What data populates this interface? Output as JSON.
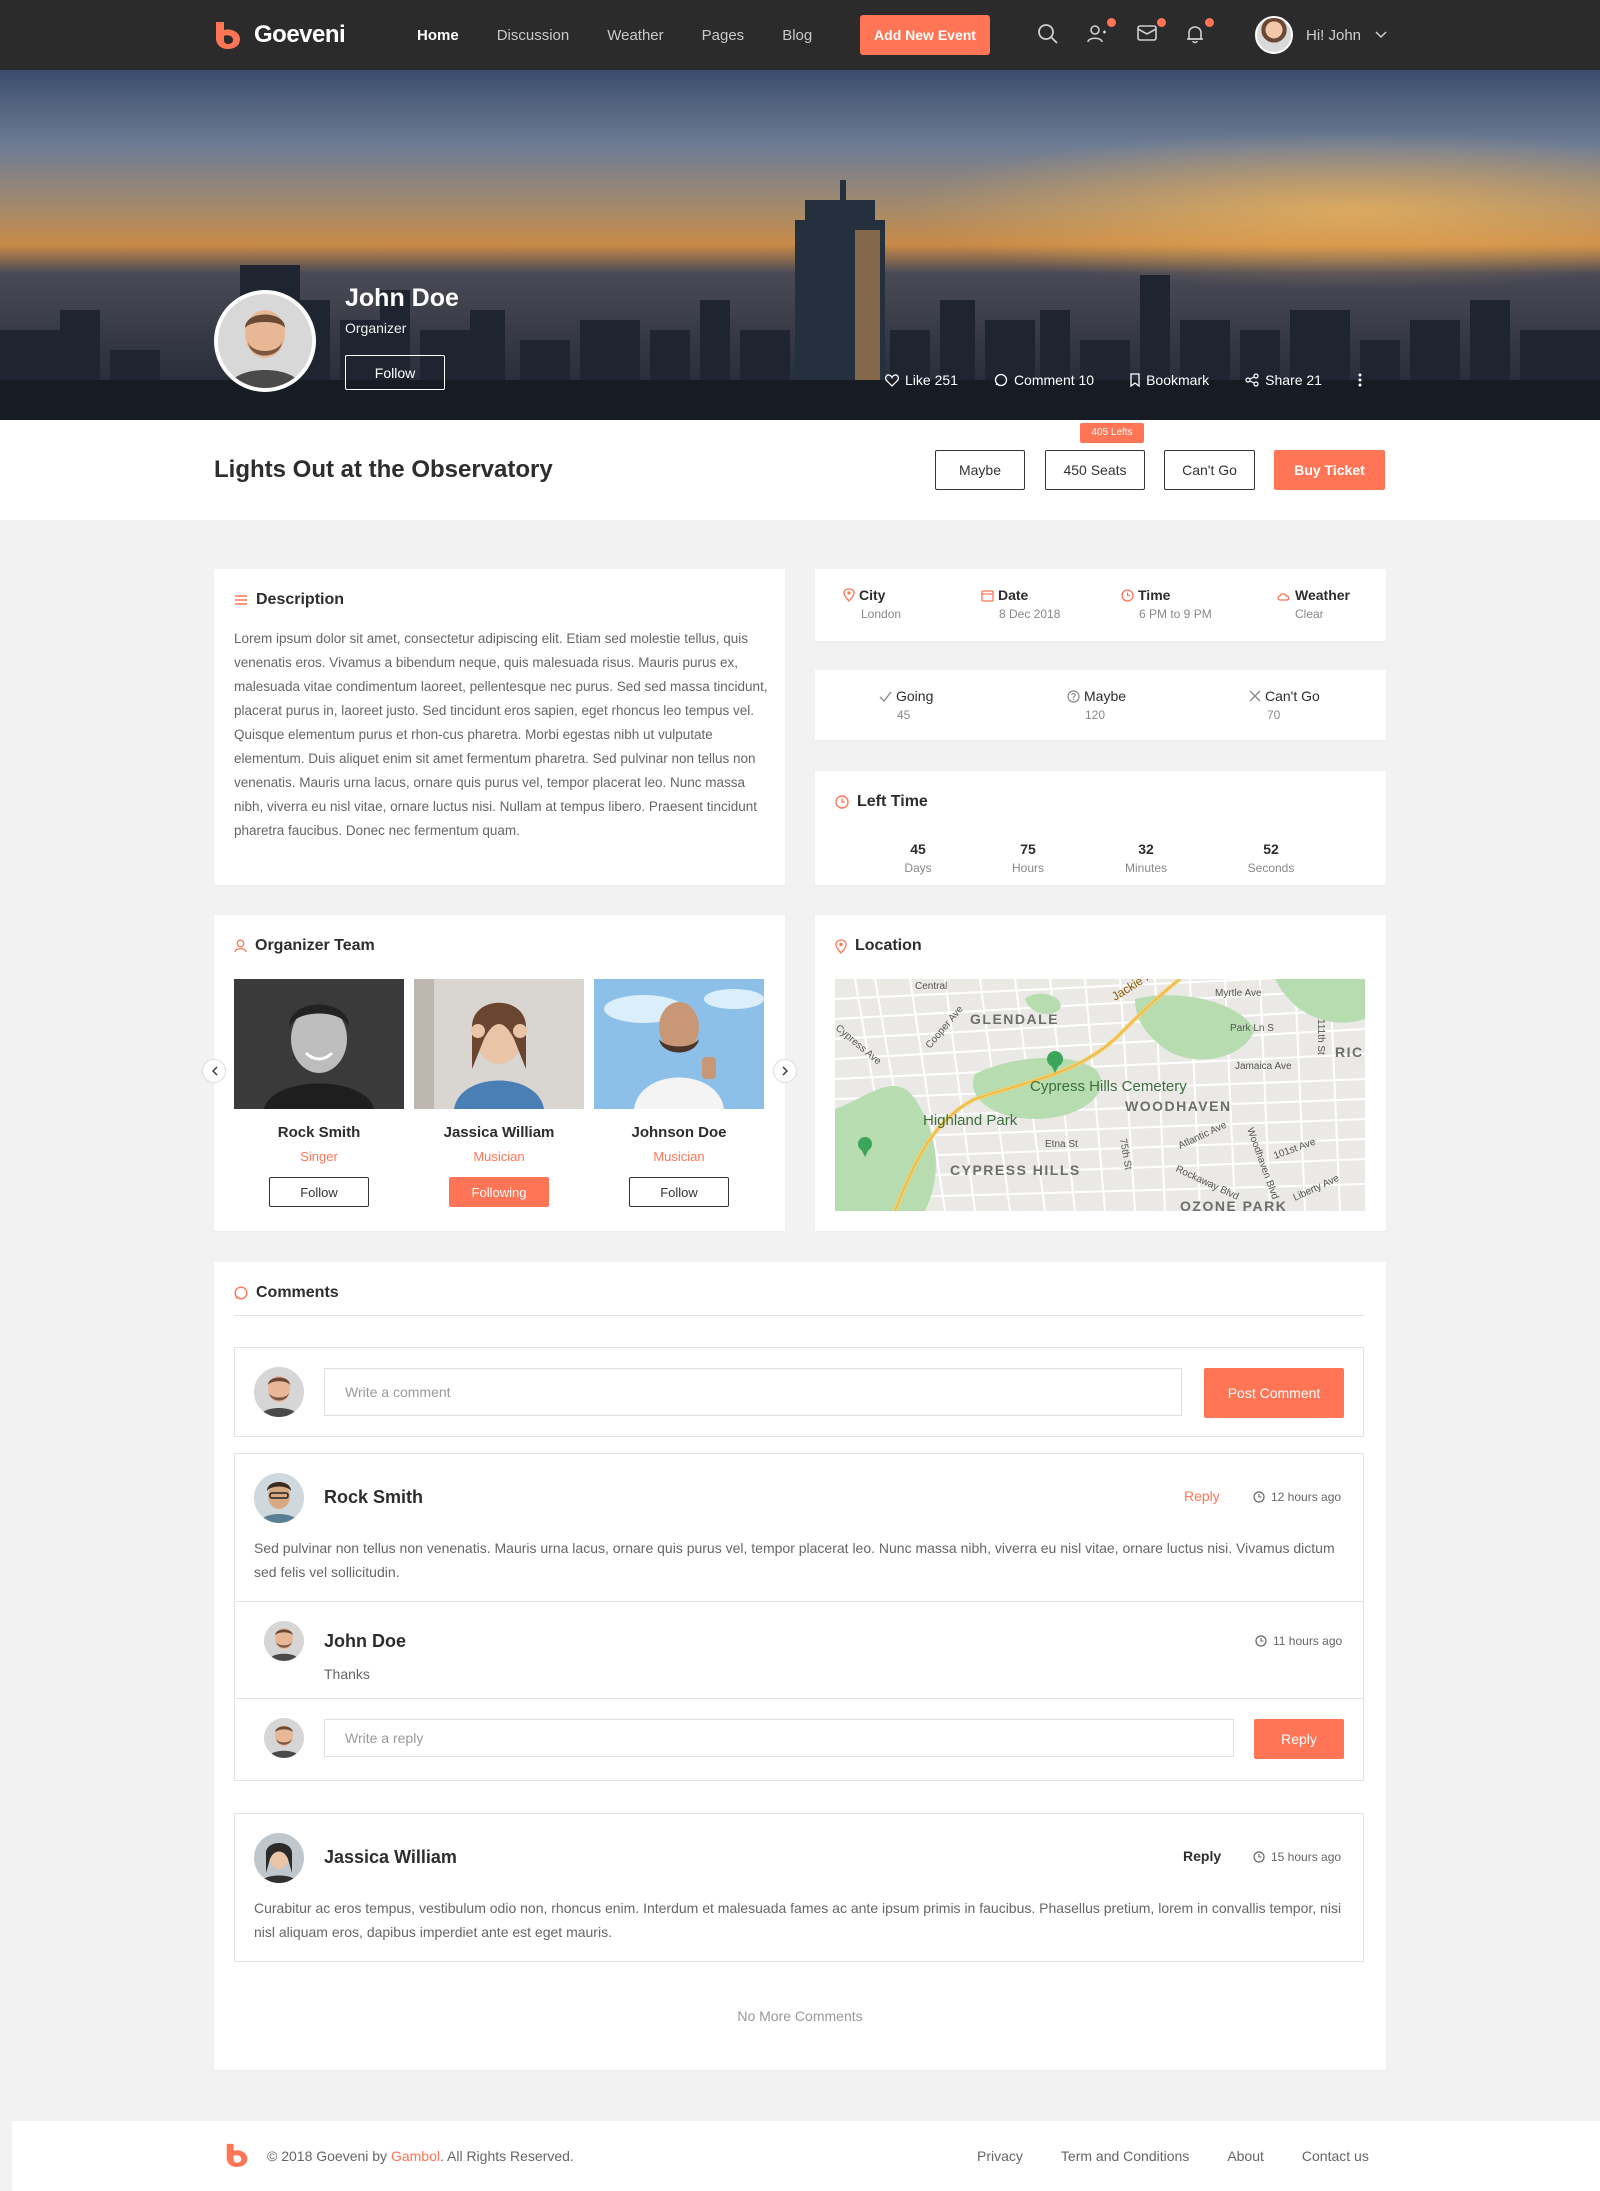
{
  "header": {
    "brand": "Goeveni",
    "nav": [
      "Home",
      "Discussion",
      "Weather",
      "Pages",
      "Blog"
    ],
    "add_event": "Add New Event",
    "greeting": "Hi! John"
  },
  "hero": {
    "name": "John Doe",
    "role": "Organizer",
    "follow": "Follow",
    "actions": {
      "like": "Like 251",
      "comment": "Comment 10",
      "bookmark": "Bookmark",
      "share": "Share 21"
    }
  },
  "event": {
    "title": "Lights Out at the Observatory",
    "maybe": "Maybe",
    "seats": "450 Seats",
    "lefts": "405 Lefts",
    "cant_go": "Can't Go",
    "buy": "Buy Ticket"
  },
  "description": {
    "title": "Description",
    "text": "Lorem ipsum dolor sit amet, consectetur adipiscing elit. Etiam sed molestie tellus, quis venenatis eros. Vivamus a bibendum neque, quis malesuada risus. Mauris purus ex, malesuada vitae condimentum laoreet, pellentesque nec purus. Sed sed massa tincidunt, placerat purus in, laoreet justo. Sed tincidunt eros sapien, eget rhoncus leo tempus vel. Quisque elementum purus et rhon-cus pharetra. Morbi egestas nibh ut vulputate elementum. Duis aliquet enim sit amet fermentum pharetra. Sed pulvinar non tellus non venenatis. Mauris urna lacus, ornare quis purus vel, tempor placerat leo. Nunc massa nibh, viverra eu nisl vitae, ornare luctus nisi. Nullam at tempus libero. Praesent tincidunt pharetra faucibus. Donec nec fermentum quam."
  },
  "info": [
    {
      "label": "City",
      "value": "London"
    },
    {
      "label": "Date",
      "value": "8 Dec 2018"
    },
    {
      "label": "Time",
      "value": "6 PM to 9 PM"
    },
    {
      "label": "Weather",
      "value": "Clear"
    }
  ],
  "attendance": [
    {
      "label": "Going",
      "value": "45"
    },
    {
      "label": "Maybe",
      "value": "120"
    },
    {
      "label": "Can't Go",
      "value": "70"
    }
  ],
  "countdown": {
    "title": "Left Time",
    "items": [
      {
        "num": "45",
        "label": "Days"
      },
      {
        "num": "75",
        "label": "Hours"
      },
      {
        "num": "32",
        "label": "Minutes"
      },
      {
        "num": "52",
        "label": "Seconds"
      }
    ]
  },
  "team": {
    "title": "Organizer Team",
    "members": [
      {
        "name": "Rock Smith",
        "role": "Singer",
        "button": "Follow"
      },
      {
        "name": "Jassica William",
        "role": "Musician",
        "button": "Following"
      },
      {
        "name": "Johnson Doe",
        "role": "Musician",
        "button": "Follow"
      }
    ]
  },
  "location": {
    "title": "Location",
    "map_labels": [
      "GLENDALE",
      "Cypress Hills Cemetery",
      "Highland Park",
      "WOODHAVEN",
      "CYPRESS HILLS",
      "OZONE PARK",
      "RIC",
      "Jackie Robinson Pkwy",
      "Myrtle Ave",
      "Jamaica Ave",
      "Atlantic Ave",
      "Etna St",
      "75th St",
      "101st Ave",
      "Liberty Ave",
      "Rockaway Blvd",
      "Woodhaven Blvd",
      "Cooper Ave",
      "Central",
      "Park Ln S",
      "111th St",
      "Cypress Ave"
    ]
  },
  "comments": {
    "title": "Comments",
    "placeholder": "Write a comment",
    "post": "Post Comment",
    "list": [
      {
        "name": "Rock Smith",
        "reply": "Reply",
        "time": "12 hours ago",
        "text": "Sed pulvinar non tellus non venenatis. Mauris urna lacus, ornare quis purus vel, tempor placerat leo. Nunc massa nibh, viverra eu nisl vitae, ornare luctus nisi. Vivamus dictum sed felis vel sollicitudin."
      },
      {
        "name": "John Doe",
        "time": "11 hours ago",
        "text": "Thanks"
      },
      {
        "name": "Jassica William",
        "reply": "Reply",
        "time": "15 hours ago",
        "text": "Curabitur ac eros tempus, vestibulum odio non, rhoncus enim. Interdum et malesuada fames ac ante ipsum primis in faucibus. Phasellus pretium, lorem in convallis tempor, nisi nisl aliquam eros, dapibus imperdiet ante est eget mauris."
      }
    ],
    "reply_placeholder": "Write a reply",
    "reply_button": "Reply",
    "no_more": "No More Comments"
  },
  "footer": {
    "copyright_prefix": "© 2018 Goeveni by",
    "brand": "Gambol",
    "copyright_suffix": ". All Rights Reserved.",
    "links": [
      "Privacy",
      "Term and Conditions",
      "About",
      "Contact us"
    ]
  },
  "colors": {
    "accent": "#ff7555",
    "header_bg": "#2b2b2b",
    "page_bg": "#f2f2f2"
  }
}
